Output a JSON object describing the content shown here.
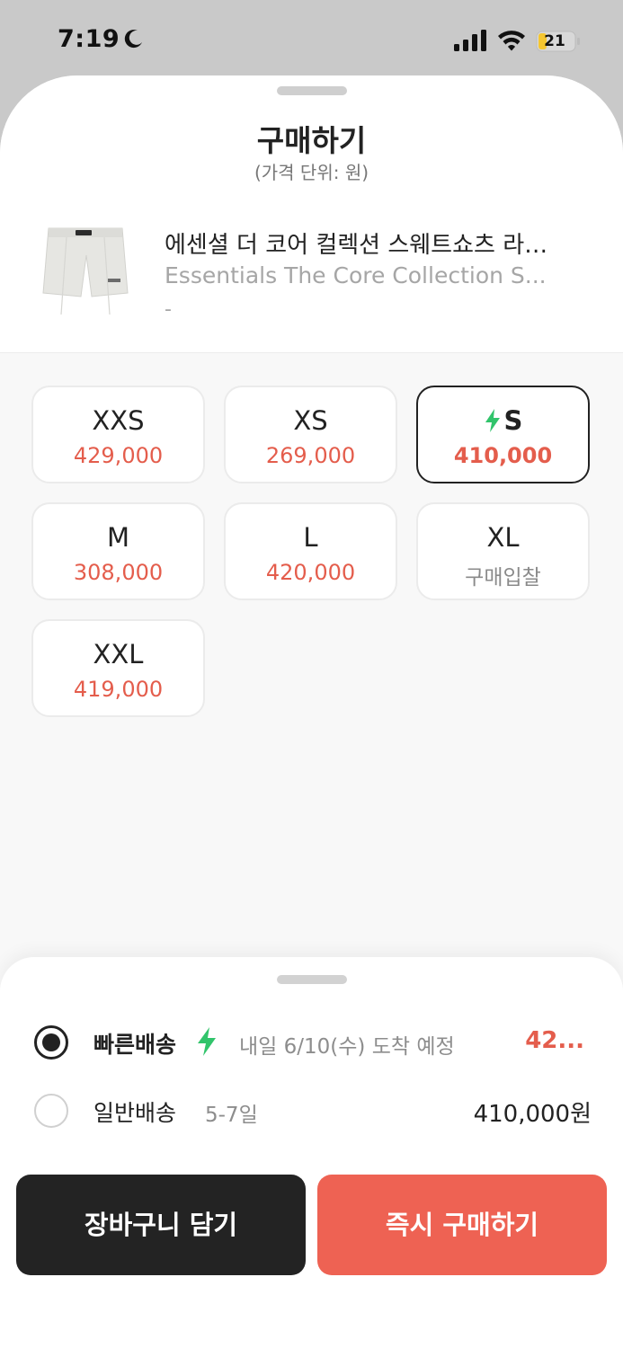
{
  "status_bar": {
    "time": "7:19",
    "battery": "21"
  },
  "sheet": {
    "title": "구매하기",
    "subtitle": "(가격 단위: 원)"
  },
  "product": {
    "name_ko": "에센셜 더 코어 컬렉션 스웨트쇼츠 라…",
    "name_en": "Essentials The Core Collection S...",
    "option": "-"
  },
  "sizes": [
    {
      "label": "XXS",
      "price": "429,000"
    },
    {
      "label": "XS",
      "price": "269,000"
    },
    {
      "label": "S",
      "price": "410,000",
      "selected": true,
      "fast": true
    },
    {
      "label": "M",
      "price": "308,000"
    },
    {
      "label": "L",
      "price": "420,000"
    },
    {
      "label": "XL",
      "price": "구매입찰"
    },
    {
      "label": "XXL",
      "price": "419,000"
    }
  ],
  "shipping": {
    "fast": {
      "name": "빠른배송",
      "desc": "내일 6/10(수) 도착 예정",
      "price": "42..."
    },
    "normal": {
      "name": "일반배송",
      "desc": "5-7일",
      "price": "410,000원"
    }
  },
  "buttons": {
    "cart": "장바구니 담기",
    "buy": "즉시 구매하기"
  },
  "colors": {
    "accent_red": "#e45d4c",
    "buy_button": "#ee6253",
    "cart_button": "#232323",
    "bolt_green": "#31c46b"
  }
}
